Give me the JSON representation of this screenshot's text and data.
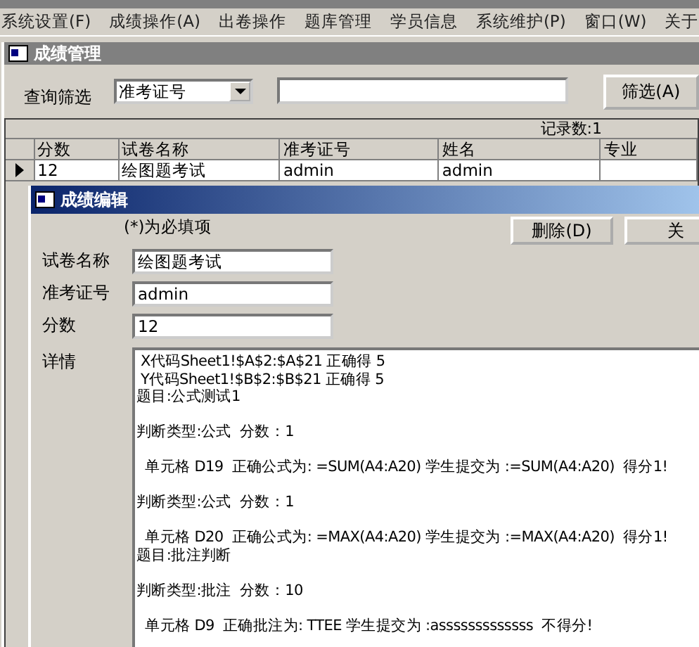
{
  "menu": [
    "系统设置(F)",
    "成绩操作(A)",
    "出卷操作",
    "题库管理",
    "学员信息",
    "系统维护(P)",
    "窗口(W)",
    "关于"
  ],
  "child_window": {
    "title": "成绩管理",
    "filter": {
      "label": "查询筛选",
      "field": "准考证号",
      "button": "筛选(A)"
    },
    "grid": {
      "record_count": "记录数:1",
      "columns": [
        "分数",
        "试卷名称",
        "准考证号",
        "姓名",
        "专业"
      ],
      "rows": [
        {
          "selected": true,
          "cells": [
            "12",
            "绘图题考试",
            "admin",
            "admin"
          ]
        }
      ]
    }
  },
  "dialog": {
    "title": "成绩编辑",
    "note": "(*)为必填项",
    "buttons": [
      "删除(D)",
      "关"
    ],
    "fields": [
      {
        "label": "试卷名称",
        "value": "绘图题考试"
      },
      {
        "label": "准考证号",
        "value": "admin"
      },
      {
        "label": "分数",
        "value": "12"
      }
    ],
    "details": {
      "label": "详情",
      "paragraphs": [
        [
          " X代码Sheet1!$A$2:$A$21 正确得 5",
          " Y代码Sheet1!$B$2:$B$21 正确得 5",
          "题目:公式测试1"
        ],
        [
          "判断类型:公式  分数：1"
        ],
        [
          "  单元格 D19  正确公式为: =SUM(A4:A20) 学生提交为 :=SUM(A4:A20)  得分1!"
        ],
        [
          "判断类型:公式  分数：1"
        ],
        [
          "  单元格 D20  正确公式为: =MAX(A4:A20) 学生提交为 :=MAX(A4:A20)  得分1!",
          "题目:批注判断"
        ],
        [
          "判断类型:批注  分数：10"
        ],
        [
          "  单元格 D9  正确批注为: TTEE 学生提交为 :asssssssssssss  不得分!"
        ]
      ]
    }
  }
}
